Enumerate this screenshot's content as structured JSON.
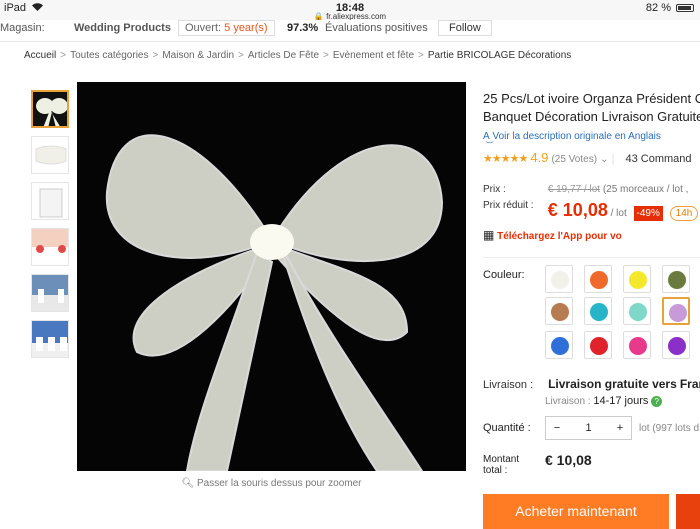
{
  "status_bar": {
    "device": "iPad",
    "time": "18:48",
    "url": "fr.aliexpress.com",
    "battery": "82 %"
  },
  "store_bar": {
    "store_label": "Magasin:",
    "store_name": "Wedding Products",
    "open_label": "Ouvert:",
    "open_value": "5 year(s)",
    "rating_pct": "97.3%",
    "rating_label": "Évaluations positives",
    "follow": "Follow"
  },
  "breadcrumb": [
    "Accueil",
    "Toutes catégories",
    "Maison & Jardin",
    "Articles De Fête",
    "Evènement et fête",
    "Partie BRICOLAGE Décorations"
  ],
  "product": {
    "title_line1": "25 Pcs/Lot ivoire Organza Président C",
    "title_line2": "Banquet Décoration Livraison Gratuite",
    "translate_link": "Voir la description originale en Anglais",
    "rating": "4.9",
    "votes": "(25 Votes)",
    "orders": "43 Command",
    "price_label": "Prix :",
    "old_price": "€ 19,77 / lot",
    "old_price_note": "(25 morceaux / lot ,",
    "reduced_label": "Prix réduit :",
    "price": "€ 10,08",
    "unit": "/ lot",
    "discount": "-49%",
    "timer": "14h",
    "app_link": "Téléchargez l'App pour vo",
    "color_label": "Couleur:",
    "shipping_label": "Livraison :",
    "shipping_value": "Livraison gratuite vers",
    "shipping_dest": "Fran",
    "delivery_label": "Livraison :",
    "delivery_value": "14-17 jours",
    "qty_label": "Quantité :",
    "qty_minus": "−",
    "qty_value": "1",
    "qty_plus": "+",
    "qty_note": "lot (997 lots d",
    "total_label_1": "Montant",
    "total_label_2": "total :",
    "total": "€ 10,08",
    "buy_now": "Acheter maintenant",
    "zoom_hint": "Passer la souris dessus pour zoomer"
  },
  "swatch_colors": [
    "#f1f1ea",
    "#ef6a2a",
    "#f4e82a",
    "#6b7a3e",
    "#b77b52",
    "#27b4c8",
    "#7ed7c8",
    "#c89ad8",
    "#2f6fd8",
    "#e0232a",
    "#e73a8a",
    "#8a2fc8"
  ],
  "selected_swatch": 7
}
